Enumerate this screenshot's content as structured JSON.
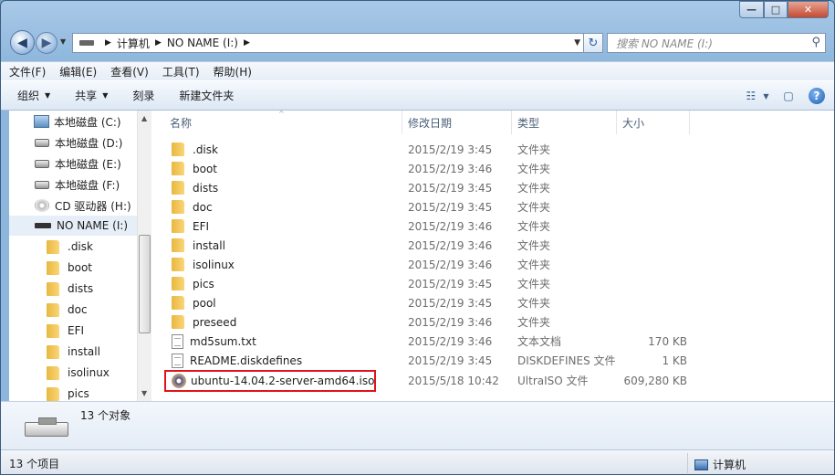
{
  "window": {
    "min_label": "—",
    "max_label": "□",
    "close_label": "✕"
  },
  "nav": {
    "back_glyph": "◀",
    "forward_glyph": "▶",
    "dropdown_glyph": "▼",
    "refresh_glyph": "↻"
  },
  "address": {
    "segments": [
      "计算机",
      "NO NAME (I:)"
    ],
    "sep_glyph": "▶",
    "drop_glyph": "▼"
  },
  "search": {
    "placeholder": "搜索 NO NAME (I:)",
    "icon": "search-icon",
    "glyph": "⚲"
  },
  "menu": [
    "文件(F)",
    "编辑(E)",
    "查看(V)",
    "工具(T)",
    "帮助(H)"
  ],
  "toolbar": {
    "organize": "组织",
    "share": "共享",
    "burn": "刻录",
    "new_folder": "新建文件夹",
    "arrow": "▼",
    "help_glyph": "?",
    "view_glyph": "☷",
    "pane_glyph": "▢"
  },
  "sidebar": {
    "drives": [
      {
        "label": "本地磁盘 (C:)",
        "icon": "system-drive-icon"
      },
      {
        "label": "本地磁盘 (D:)",
        "icon": "drive-icon"
      },
      {
        "label": "本地磁盘 (E:)",
        "icon": "drive-icon"
      },
      {
        "label": "本地磁盘 (F:)",
        "icon": "drive-icon"
      },
      {
        "label": "CD 驱动器 (H:)",
        "icon": "cd-drive-icon"
      },
      {
        "label": "NO NAME (I:)",
        "icon": "usb-drive-icon",
        "selected": true
      }
    ],
    "folders": [
      ".disk",
      "boot",
      "dists",
      "doc",
      "EFI",
      "install",
      "isolinux",
      "pics"
    ],
    "scroll_up": "▲",
    "scroll_down": "▼"
  },
  "columns": {
    "name": "名称",
    "modified": "修改日期",
    "type": "类型",
    "size": "大小",
    "sort_glyph": "^"
  },
  "files": [
    {
      "name": ".disk",
      "date": "2015/2/19 3:45",
      "type": "文件夹",
      "size": "",
      "kind": "folder"
    },
    {
      "name": "boot",
      "date": "2015/2/19 3:46",
      "type": "文件夹",
      "size": "",
      "kind": "folder"
    },
    {
      "name": "dists",
      "date": "2015/2/19 3:45",
      "type": "文件夹",
      "size": "",
      "kind": "folder"
    },
    {
      "name": "doc",
      "date": "2015/2/19 3:45",
      "type": "文件夹",
      "size": "",
      "kind": "folder"
    },
    {
      "name": "EFI",
      "date": "2015/2/19 3:46",
      "type": "文件夹",
      "size": "",
      "kind": "folder"
    },
    {
      "name": "install",
      "date": "2015/2/19 3:46",
      "type": "文件夹",
      "size": "",
      "kind": "folder"
    },
    {
      "name": "isolinux",
      "date": "2015/2/19 3:46",
      "type": "文件夹",
      "size": "",
      "kind": "folder"
    },
    {
      "name": "pics",
      "date": "2015/2/19 3:45",
      "type": "文件夹",
      "size": "",
      "kind": "folder"
    },
    {
      "name": "pool",
      "date": "2015/2/19 3:45",
      "type": "文件夹",
      "size": "",
      "kind": "folder"
    },
    {
      "name": "preseed",
      "date": "2015/2/19 3:46",
      "type": "文件夹",
      "size": "",
      "kind": "folder"
    },
    {
      "name": "md5sum.txt",
      "date": "2015/2/19 3:46",
      "type": "文本文档",
      "size": "170 KB",
      "kind": "text"
    },
    {
      "name": "README.diskdefines",
      "date": "2015/2/19 3:45",
      "type": "DISKDEFINES 文件",
      "size": "1 KB",
      "kind": "text"
    },
    {
      "name": "ubuntu-14.04.2-server-amd64.iso",
      "date": "2015/5/18 10:42",
      "type": "UltraISO 文件",
      "size": "609,280 KB",
      "kind": "iso",
      "highlighted": true
    }
  ],
  "details": {
    "count": "13 个对象"
  },
  "status": {
    "items": "13 个项目",
    "location": "计算机"
  }
}
